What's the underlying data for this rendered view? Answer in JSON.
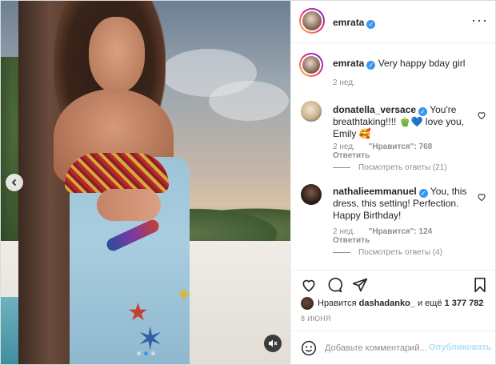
{
  "post": {
    "author": "emrata",
    "verified": true
  },
  "comments": [
    {
      "username": "emrata",
      "text": "Very happy bday girl",
      "time": "2 нед."
    },
    {
      "username": "donatella_versace",
      "text": "You're breathtaking!!!! 🫑💙 love you, Emily 🥰",
      "time": "2 нед.",
      "likes": "\"Нравится\": 768",
      "reply": "Ответить",
      "view_replies": "Посмотреть ответы (21)"
    },
    {
      "username": "nathalieemmanuel",
      "text": "You, this dress, this setting! Perfection. Happy Birthday!",
      "time": "2 нед.",
      "likes": "\"Нравится\": 124",
      "reply": "Ответить",
      "view_replies": "Посмотреть ответы (4)"
    }
  ],
  "likes": {
    "prefix": "Нравится",
    "user": "dashadanko_",
    "middle": "и ещё",
    "count": "1 377 782"
  },
  "date": "8 ИЮНЯ",
  "add_comment": {
    "placeholder": "Добавьте комментарий...",
    "publish_label": "Опубликовать"
  },
  "icons": {
    "more": "more-options-icon",
    "like": "heart-icon",
    "comment": "comment-icon",
    "share": "share-icon",
    "save": "bookmark-icon",
    "prev": "chevron-left-icon",
    "mute": "volume-muted-icon",
    "emoji": "smiley-icon"
  },
  "colors": {
    "accent": "#3897f0",
    "publish_disabled": "#b2dffc",
    "muted_text": "#8e8e8e"
  },
  "carousel": {
    "total": 3,
    "active": 2
  }
}
